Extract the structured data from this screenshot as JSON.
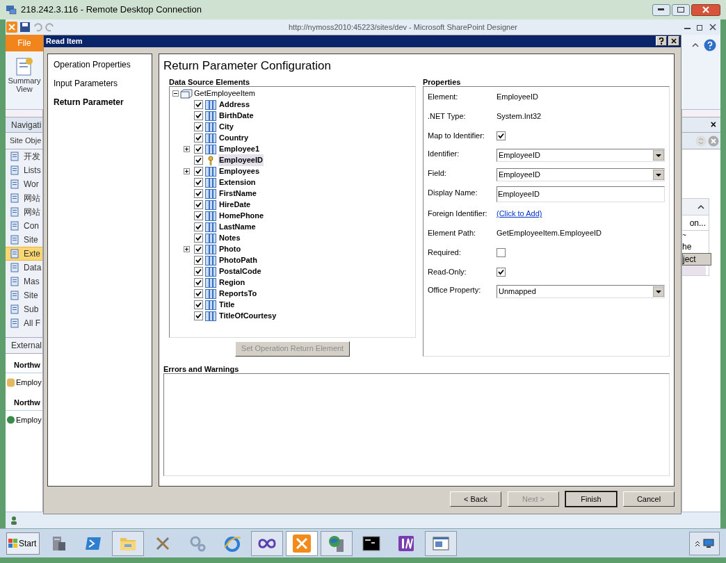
{
  "rdp_window": {
    "title": "218.242.3.116 - Remote Desktop Connection"
  },
  "app": {
    "title": "http://nymoss2010:45223/sites/dev -  Microsoft SharePoint Designer",
    "file_tab": "File",
    "ribbon_button": "Summary View",
    "navigation": {
      "header": "Navigati",
      "section": "Site Obje",
      "items": [
        {
          "label": "开发",
          "selected": false
        },
        {
          "label": "Lists",
          "selected": false
        },
        {
          "label": "Wor",
          "selected": false
        },
        {
          "label": "网站",
          "selected": false
        },
        {
          "label": "网站",
          "selected": false
        },
        {
          "label": "Con",
          "selected": false
        },
        {
          "label": "Site",
          "selected": false
        },
        {
          "label": "Exte",
          "selected": true
        },
        {
          "label": "Data",
          "selected": false
        },
        {
          "label": "Mas",
          "selected": false
        },
        {
          "label": "Site",
          "selected": false
        },
        {
          "label": "Sub",
          "selected": false
        },
        {
          "label": "All F",
          "selected": false
        }
      ],
      "external_header": "External",
      "groups": [
        {
          "title": "Northw",
          "item": "Employ"
        },
        {
          "title": "Northw",
          "item": "Employ"
        }
      ]
    },
    "side_panel": {
      "close": "×",
      "lines": [
        "on...",
        "~",
        "he"
      ],
      "button": "ject"
    }
  },
  "dialog": {
    "title": "Read Item",
    "steps": [
      {
        "label": "Operation Properties",
        "selected": false
      },
      {
        "label": "Input Parameters",
        "selected": false
      },
      {
        "label": "Return Parameter",
        "selected": true
      }
    ],
    "heading": "Return Parameter Configuration",
    "data_source": {
      "label": "Data Source Elements",
      "root": {
        "label": "GetEmployeeItem",
        "expanded": true,
        "children": [
          {
            "label": "Address",
            "kind": "field",
            "checked": true,
            "selected": false
          },
          {
            "label": "BirthDate",
            "kind": "field",
            "checked": true,
            "selected": false
          },
          {
            "label": "City",
            "kind": "field",
            "checked": true,
            "selected": false
          },
          {
            "label": "Country",
            "kind": "field",
            "checked": true,
            "selected": false
          },
          {
            "label": "Employee1",
            "kind": "collection",
            "checked": true,
            "selected": false
          },
          {
            "label": "EmployeeID",
            "kind": "key",
            "checked": true,
            "selected": true
          },
          {
            "label": "Employees",
            "kind": "collection",
            "checked": true,
            "selected": false
          },
          {
            "label": "Extension",
            "kind": "field",
            "checked": true,
            "selected": false
          },
          {
            "label": "FirstName",
            "kind": "field",
            "checked": true,
            "selected": false
          },
          {
            "label": "HireDate",
            "kind": "field",
            "checked": true,
            "selected": false
          },
          {
            "label": "HomePhone",
            "kind": "field",
            "checked": true,
            "selected": false
          },
          {
            "label": "LastName",
            "kind": "field",
            "checked": true,
            "selected": false
          },
          {
            "label": "Notes",
            "kind": "field",
            "checked": true,
            "selected": false
          },
          {
            "label": "Photo",
            "kind": "collection",
            "checked": true,
            "selected": false
          },
          {
            "label": "PhotoPath",
            "kind": "field",
            "checked": true,
            "selected": false
          },
          {
            "label": "PostalCode",
            "kind": "field",
            "checked": true,
            "selected": false
          },
          {
            "label": "Region",
            "kind": "field",
            "checked": true,
            "selected": false
          },
          {
            "label": "ReportsTo",
            "kind": "field",
            "checked": true,
            "selected": false
          },
          {
            "label": "Title",
            "kind": "field",
            "checked": true,
            "selected": false
          },
          {
            "label": "TitleOfCourtesy",
            "kind": "field",
            "checked": true,
            "selected": false
          }
        ]
      },
      "button": {
        "label": "Set Operation Return Element",
        "disabled": true
      }
    },
    "properties": {
      "label": "Properties",
      "rows": [
        {
          "kind": "text",
          "label": "Element:",
          "value": "EmployeeID"
        },
        {
          "kind": "text",
          "label": ".NET Type:",
          "value": "System.Int32"
        },
        {
          "kind": "checkbox",
          "label": "Map to Identifier:",
          "checked": true
        },
        {
          "kind": "dropdown",
          "label": "Identifier:",
          "value": "EmployeeID"
        },
        {
          "kind": "dropdown",
          "label": "Field:",
          "value": "EmployeeID"
        },
        {
          "kind": "input",
          "label": "Display Name:",
          "value": "EmployeeID"
        },
        {
          "kind": "link",
          "label": "Foreign Identifier:",
          "value": "(Click to Add)"
        },
        {
          "kind": "text",
          "label": "Element Path:",
          "value": "GetEmployeeItem.EmployeeID"
        },
        {
          "kind": "checkbox",
          "label": "Required:",
          "checked": false
        },
        {
          "kind": "checkbox",
          "label": "Read-Only:",
          "checked": true
        },
        {
          "kind": "dropdown",
          "label": "Office Property:",
          "value": "Unmapped"
        }
      ]
    },
    "errors": {
      "label": "Errors and Warnings"
    },
    "buttons": [
      {
        "label": "< Back",
        "disabled": false,
        "default": false
      },
      {
        "label": "Next >",
        "disabled": true,
        "default": false
      },
      {
        "label": "Finish",
        "disabled": false,
        "default": true
      },
      {
        "label": "Cancel",
        "disabled": false,
        "default": false
      }
    ]
  },
  "taskbar": {
    "start": "Start",
    "apps": [
      {
        "kind": "server",
        "running": false,
        "selected": false
      },
      {
        "kind": "shell",
        "running": false,
        "selected": false
      },
      {
        "kind": "folder",
        "running": true,
        "selected": false
      },
      {
        "kind": "tools",
        "running": false,
        "selected": false
      },
      {
        "kind": "gears",
        "running": false,
        "selected": false
      },
      {
        "kind": "browser",
        "running": false,
        "selected": false
      },
      {
        "kind": "infinity",
        "running": true,
        "selected": false
      },
      {
        "kind": "wrench",
        "running": true,
        "selected": true
      },
      {
        "kind": "globe",
        "running": true,
        "selected": false
      },
      {
        "kind": "console",
        "running": false,
        "selected": false
      },
      {
        "kind": "notebook",
        "running": false,
        "selected": false
      },
      {
        "kind": "window",
        "running": true,
        "selected": false
      }
    ]
  }
}
